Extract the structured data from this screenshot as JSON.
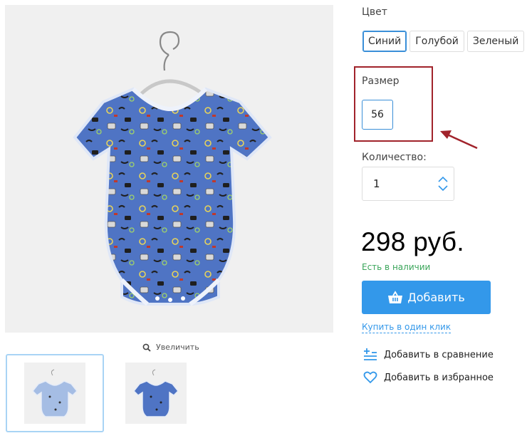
{
  "gallery": {
    "zoom_label": "Увеличить",
    "thumbnails": [
      {
        "name": "thumbnail-1",
        "selected": true
      },
      {
        "name": "thumbnail-2",
        "selected": false
      }
    ]
  },
  "options": {
    "color_label": "Цвет",
    "colors": [
      {
        "label": "Синий",
        "selected": true
      },
      {
        "label": "Голубой",
        "selected": false
      },
      {
        "label": "Зеленый",
        "selected": false
      }
    ],
    "size_label": "Размер",
    "sizes": [
      {
        "label": "56",
        "selected": true
      }
    ],
    "quantity_label": "Количество:",
    "quantity_value": "1"
  },
  "price": "298 руб.",
  "stock_status": "Есть в наличии",
  "add_button_label": "Добавить",
  "one_click_label": "Купить в один клик",
  "compare_label": "Добавить в сравнение",
  "favorite_label": "Добавить в избранное",
  "colors": {
    "accent": "#3398ea",
    "in_stock": "#3aa55a",
    "highlight": "#a1232b",
    "selected_border": "#3a8fd8"
  },
  "icons": [
    "search-icon",
    "chevron-up-icon",
    "chevron-down-icon",
    "basket-icon",
    "compare-icon",
    "heart-icon"
  ]
}
